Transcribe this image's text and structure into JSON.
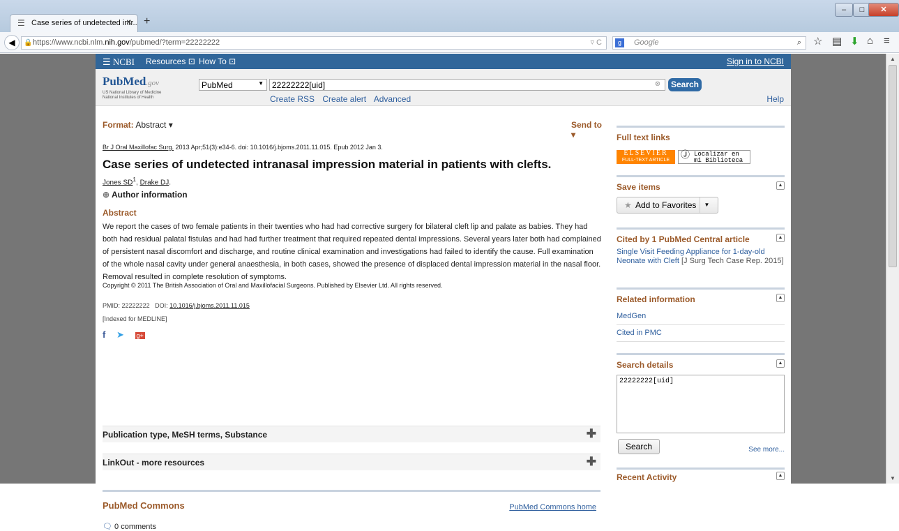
{
  "browser": {
    "tab_title": "Case series of undetected intr...",
    "new_tab": "+",
    "url_prefix": "https://www.ncbi.nlm.",
    "url_domain": "nih.gov",
    "url_path": "/pubmed/?term=22222222",
    "search_engine_placeholder": "Google",
    "icons": [
      "back-icon",
      "lock-icon",
      "reload-icon",
      "google-icon",
      "search-icon",
      "star-icon",
      "bookmarks-icon",
      "download-icon",
      "home-icon",
      "menu-icon"
    ]
  },
  "ncbi": {
    "logo": "NCBI",
    "resources": "Resources",
    "how_to": "How To",
    "sign_in": "Sign in to NCBI"
  },
  "search": {
    "logo_pub": "Pub",
    "logo_med": "Med",
    "logo_gov": ".gov",
    "nlm_line1": "US National Library of Medicine",
    "nlm_line2": "National Institutes of Health",
    "database": "PubMed",
    "query": "22222222[uid]",
    "button": "Search",
    "links": [
      "Create RSS",
      "Create alert",
      "Advanced"
    ],
    "help": "Help"
  },
  "article": {
    "format_label": "Format:",
    "format_value": "Abstract",
    "send_to": "Send to",
    "journal": "Br J Oral Maxillofac Surg.",
    "citation": "2013 Apr;51(3):e34-6. doi: 10.1016/j.bjoms.2011.11.015. Epub 2012 Jan 3.",
    "title": "Case series of undetected intranasal impression material in patients with clefts.",
    "author1": "Jones SD",
    "author1_sup": "1",
    "author2": "Drake DJ",
    "author_info": "Author information",
    "abstract_heading": "Abstract",
    "abstract": "We report the cases of two female patients in their twenties who had had corrective surgery for bilateral cleft lip and palate as babies. They had both had residual palatal fistulas and had had further treatment that required repeated dental impressions. Several years later both had complained of persistent nasal discomfort and discharge, and routine clinical examination and investigations had failed to identify the cause. Full examination of the whole nasal cavity under general anaesthesia, in both cases, showed the presence of displaced dental impression material in the nasal floor. Removal resulted in complete resolution of symptoms.",
    "copyright": "Copyright © 2011 The British Association of Oral and Maxillofacial Surgeons. Published by Elsevier Ltd. All rights reserved.",
    "pmid_label": "PMID:",
    "pmid": "22222222",
    "doi_label": "DOI:",
    "doi": "10.1016/j.bjoms.2011.11.015",
    "indexed": "[Indexed for MEDLINE]",
    "sections": [
      "Publication type, MeSH terms, Substance",
      "LinkOut - more resources"
    ],
    "commons_title": "PubMed Commons",
    "commons_home": "PubMed Commons home",
    "comments": "0 comments"
  },
  "sidebar": {
    "full_text_links": "Full text links",
    "elsevier_top": "ELSEVIER",
    "elsevier_bottom": "FULL-TEXT ARTICLE",
    "localizar": "Localizar en mi Biblioteca",
    "save_items": "Save items",
    "add_favorites": "Add to Favorites",
    "cited_by": "Cited by 1 PubMed Central article",
    "cited_article": "Single Visit Feeding Appliance for 1-day-old Neonate with Cleft",
    "cited_source": "[J Surg Tech Case Rep. 2015]",
    "related_info": "Related information",
    "related_items": [
      "MedGen",
      "Cited in PMC"
    ],
    "search_details": "Search details",
    "search_details_value": "22222222[uid]",
    "search_button": "Search",
    "see_more": "See more...",
    "recent_activity": "Recent Activity"
  }
}
